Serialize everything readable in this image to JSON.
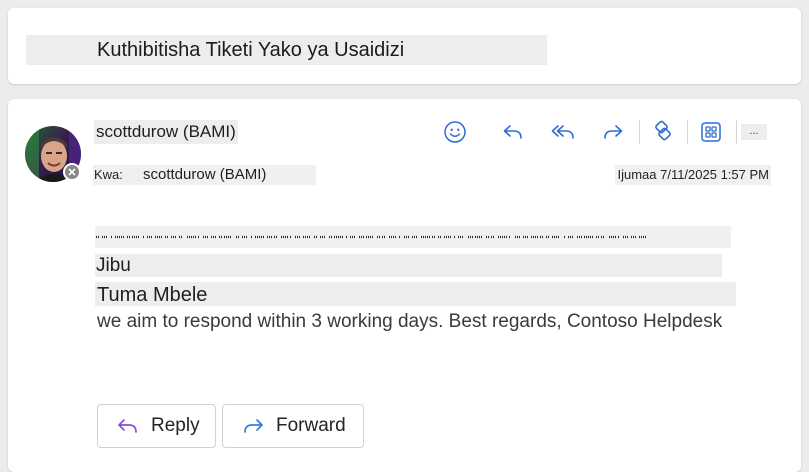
{
  "subject": {
    "title": "Kuthibitisha Tiketi Yako ya Usaidizi"
  },
  "message": {
    "sender_name": "scottdurow (BAMI)",
    "to_label": "Kwa:",
    "to_name": "scottdurow (BAMI)",
    "date": "Ijumaa 7/11/2025 1:57 PM",
    "presence_status": "offline-icon",
    "toolbar": {
      "more_label": "..."
    },
    "body": {
      "reply_heading": "Jibu",
      "forward_heading": "Tuma Mbele",
      "text": "we aim to respond within 3 working days. Best regards, Contoso Helpdesk"
    },
    "actions": {
      "reply_label": "Reply",
      "forward_label": "Forward"
    }
  },
  "colors": {
    "accent": "#2b6cd4",
    "reply_icon": "#8a4bd6",
    "forward_icon": "#3a7bd5"
  }
}
